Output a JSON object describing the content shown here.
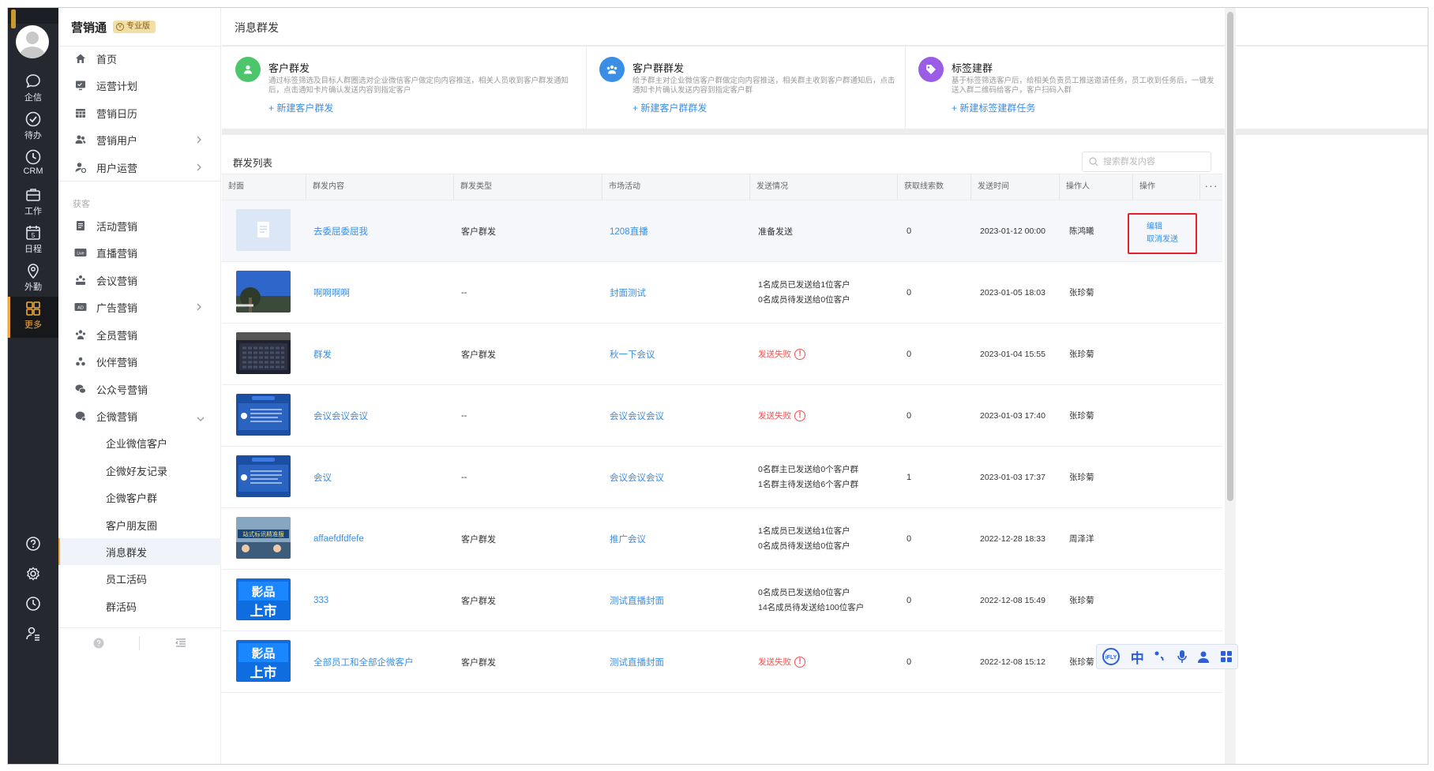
{
  "app": {
    "brand": "营销通",
    "edition": "专业版"
  },
  "rail": {
    "items": [
      {
        "label": "企信",
        "icon": "chat-bubble-icon"
      },
      {
        "label": "待办",
        "icon": "check-circle-icon"
      },
      {
        "label": "CRM",
        "icon": "clock-icon"
      },
      {
        "label": "工作",
        "icon": "briefcase-icon"
      },
      {
        "label": "日程",
        "icon": "calendar-icon"
      },
      {
        "label": "外勤",
        "icon": "location-pin-icon"
      },
      {
        "label": "更多",
        "icon": "grid-apps-icon"
      }
    ]
  },
  "menu": {
    "items": [
      {
        "label": "首页",
        "icon": "home-icon"
      },
      {
        "label": "运营计划",
        "icon": "plan-icon"
      },
      {
        "label": "营销日历",
        "icon": "calendar-grid-icon"
      },
      {
        "label": "营销用户",
        "icon": "users-icon"
      },
      {
        "label": "用户运营",
        "icon": "user-ops-icon"
      }
    ],
    "section": "获客",
    "acq_items": [
      {
        "label": "活动营销",
        "icon": "activity-icon"
      },
      {
        "label": "直播营销",
        "icon": "live-icon",
        "badge": "Live"
      },
      {
        "label": "会议营销",
        "icon": "meeting-icon"
      },
      {
        "label": "广告营销",
        "icon": "ad-icon",
        "badge": "AD"
      },
      {
        "label": "全员营销",
        "icon": "all-staff-icon"
      },
      {
        "label": "伙伴营销",
        "icon": "partner-icon"
      },
      {
        "label": "公众号营销",
        "icon": "wechat-official-icon"
      },
      {
        "label": "企微营销",
        "icon": "wecom-icon"
      }
    ],
    "sub_items": [
      "企业微信客户",
      "企微好友记录",
      "企微客户群",
      "客户朋友圈",
      "消息群发",
      "员工活码",
      "群活码"
    ]
  },
  "page": {
    "title": "消息群发"
  },
  "cards": [
    {
      "title": "客户群发",
      "desc": "通过标签筛选及目标人群圈选对企业微信客户做定向内容推送，相关人员收到客户群发通知后，点击通知卡片确认发送内容到指定客户",
      "link": "+ 新建客户群发",
      "color": "#4cc56b",
      "icon": "person-icon"
    },
    {
      "title": "客户群群发",
      "desc": "给予群主对企业微信客户群做定向内容推送，相关群主收到客户群通知后，点击通知卡片确认发送内容到指定客户群",
      "link": "+ 新建客户群群发",
      "color": "#3a8ee6",
      "icon": "group-icon"
    },
    {
      "title": "标签建群",
      "desc": "基于标签筛选客户后，给相关负责员工推送邀请任务，员工收到任务后，一键发送入群二维码给客户，客户扫码入群",
      "link": "+ 新建标签建群任务",
      "color": "#9b5de5",
      "icon": "tag-icon"
    }
  ],
  "list": {
    "title": "群发列表",
    "search_placeholder": "搜索群发内容",
    "more": "···",
    "columns": [
      "封面",
      "群发内容",
      "群发类型",
      "市场活动",
      "发送情况",
      "获取线索数",
      "发送时间",
      "操作人",
      "操作"
    ],
    "rows": [
      {
        "cover": "doc",
        "content": "去委屈委屈我",
        "type": "客户群发",
        "activity": "1208直播",
        "status": [
          "准备发送"
        ],
        "status_kind": "plain",
        "leads": "0",
        "time": "2023-01-12 00:00",
        "operator": "陈鸿曦",
        "actions": [
          "编辑",
          "取消发送"
        ]
      },
      {
        "cover": "sky",
        "content": "啊啊啊啊",
        "type": "--",
        "activity": "封面测试",
        "status": [
          "1名成员已发送给1位客户",
          "0名成员待发送给0位客户"
        ],
        "status_kind": "multi",
        "leads": "0",
        "time": "2023-01-05 18:03",
        "operator": "张珍菊"
      },
      {
        "cover": "keyboard",
        "content": "群发",
        "type": "客户群发",
        "activity": "秋一下会议",
        "status": [
          "发送失败"
        ],
        "status_kind": "fail",
        "leads": "0",
        "time": "2023-01-04 15:55",
        "operator": "张珍菊"
      },
      {
        "cover": "slide",
        "content": "会议会议会议",
        "type": "--",
        "activity": "会议会议会议",
        "status": [
          "发送失败"
        ],
        "status_kind": "fail",
        "leads": "0",
        "time": "2023-01-03 17:40",
        "operator": "张珍菊"
      },
      {
        "cover": "slide",
        "content": "会议",
        "type": "--",
        "activity": "会议会议会议",
        "status": [
          "0名群主已发送给0个客户群",
          "1名群主待发送给6个客户群"
        ],
        "status_kind": "multi",
        "leads": "1",
        "time": "2023-01-03 17:37",
        "operator": "张珍菊"
      },
      {
        "cover": "banner",
        "content": "affaefdfdfefe",
        "type": "客户群发",
        "activity": "推广会议",
        "status": [
          "1名成员已发送给1位客户",
          "0名成员待发送给0位客户"
        ],
        "status_kind": "multi",
        "leads": "0",
        "time": "2022-12-28 18:33",
        "operator": "周泽洋"
      },
      {
        "cover": "poster",
        "content": "333",
        "type": "客户群发",
        "activity": "测试直播封面",
        "status": [
          "0名成员已发送给0位客户",
          "14名成员待发送给100位客户"
        ],
        "status_kind": "multi",
        "leads": "0",
        "time": "2022-12-08 15:49",
        "operator": "张珍菊"
      },
      {
        "cover": "poster",
        "content": "全部员工和全部企微客户",
        "type": "客户群发",
        "activity": "测试直播封面",
        "status": [
          "发送失败"
        ],
        "status_kind": "fail",
        "leads": "0",
        "time": "2022-12-08 15:12",
        "operator": "张珍菊"
      }
    ]
  },
  "rail_bottom": [
    "help-icon",
    "settings-icon",
    "history-icon",
    "account-settings-icon"
  ],
  "ime": {
    "logo": "iFLY",
    "lang": "中",
    "items": [
      "punctuation-icon",
      "microphone-icon",
      "user-icon",
      "apps-icon"
    ]
  }
}
